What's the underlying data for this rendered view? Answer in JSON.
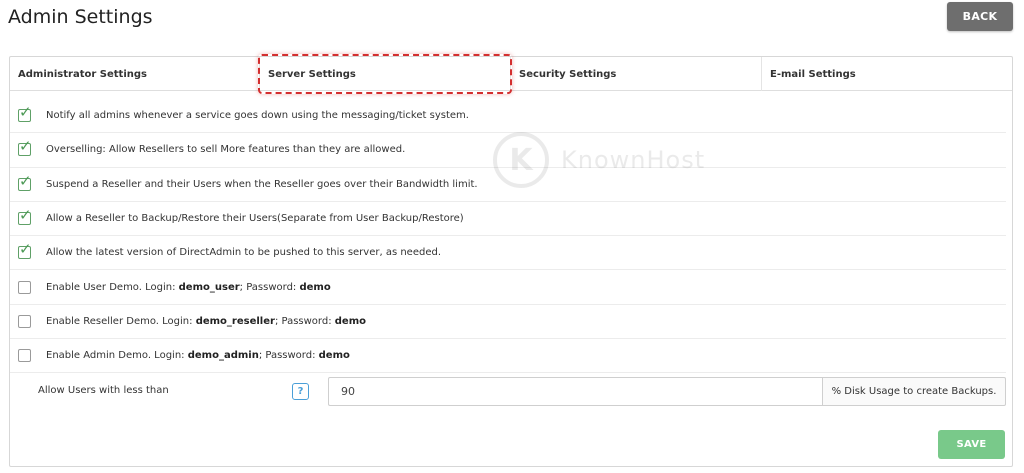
{
  "header": {
    "title": "Admin Settings",
    "back_label": "BACK"
  },
  "tabs": [
    {
      "label": "Administrator Settings"
    },
    {
      "label": "Server Settings"
    },
    {
      "label": "Security Settings"
    },
    {
      "label": "E-mail Settings"
    }
  ],
  "options": [
    {
      "text": "Notify all admins whenever a service goes down using the messaging/ticket system.",
      "checked": true
    },
    {
      "text": "Overselling: Allow Resellers to sell More features than they are allowed.",
      "checked": true
    },
    {
      "text": "Suspend a Reseller and their Users when the Reseller goes over their Bandwidth limit.",
      "checked": true
    },
    {
      "text": "Allow a Reseller to Backup/Restore their Users(Separate from User Backup/Restore)",
      "checked": true
    },
    {
      "text": "Allow the latest version of DirectAdmin to be pushed to this server, as needed.",
      "checked": true
    }
  ],
  "demos": [
    {
      "prefix": "Enable User Demo. Login: ",
      "login": "demo_user",
      "mid": "; Password: ",
      "password": "demo",
      "checked": false
    },
    {
      "prefix": "Enable Reseller Demo. Login: ",
      "login": "demo_reseller",
      "mid": "; Password: ",
      "password": "demo",
      "checked": false
    },
    {
      "prefix": "Enable Admin Demo. Login: ",
      "login": "demo_admin",
      "mid": "; Password: ",
      "password": "demo",
      "checked": false
    }
  ],
  "disk_usage": {
    "label": "Allow Users with less than",
    "help_icon": "?",
    "value": "90",
    "suffix": "% Disk Usage to create Backups."
  },
  "save_label": "SAVE",
  "watermark": {
    "logo_glyph": "K",
    "text": "KnownHost"
  },
  "colors": {
    "back_button": "#6e6e6e",
    "save_button": "#79c98a",
    "check_green": "#4e9a57",
    "highlight_red": "#d32f2f",
    "help_blue": "#4a9fd8"
  }
}
